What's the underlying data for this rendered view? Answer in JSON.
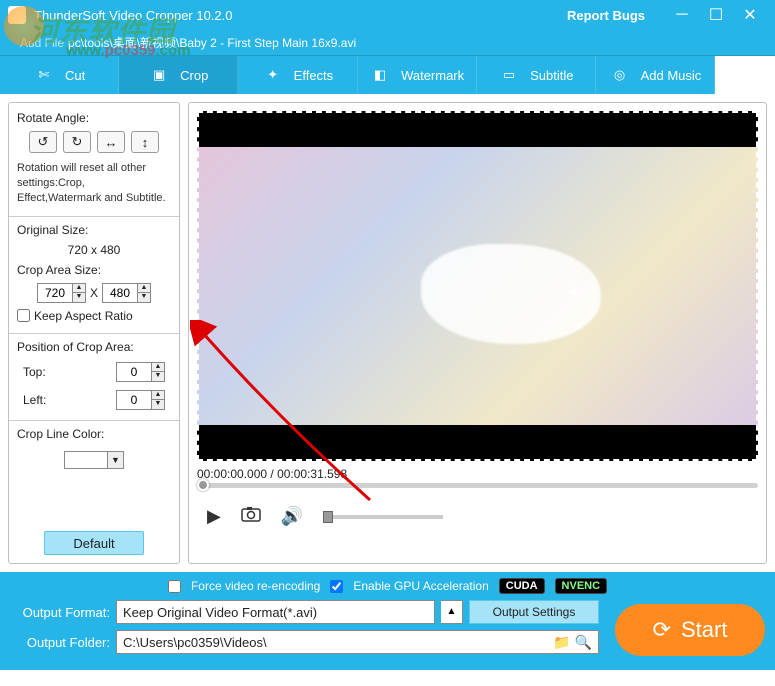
{
  "title": "ThunderSoft Video Cropper 10.2.0",
  "titlebar": {
    "report_bugs": "Report Bugs"
  },
  "subbar": {
    "added_file_path": "pc\\tools\\桌面\\新视频\\Baby 2 - First Step Main 16x9.avi"
  },
  "tabs": {
    "cut": "Cut",
    "crop": "Crop",
    "effects": "Effects",
    "watermark": "Watermark",
    "subtitle": "Subtitle",
    "add_music": "Add Music"
  },
  "left": {
    "rotate_angle": "Rotate Angle:",
    "note": "Rotation will reset all other settings:Crop, Effect,Watermark and Subtitle.",
    "original_size_label": "Original Size:",
    "original_size_value": "720 x 480",
    "crop_area_size_label": "Crop Area Size:",
    "crop_w": "720",
    "crop_h": "480",
    "keep_aspect": "Keep Aspect Ratio",
    "position_label": "Position of Crop Area:",
    "top_label": "Top:",
    "top_val": "0",
    "left_label": "Left:",
    "left_val": "0",
    "crop_line_color": "Crop Line Color:",
    "default_btn": "Default"
  },
  "preview": {
    "time": "00:00:00.000 / 00:00:31.598"
  },
  "bottom": {
    "force_reencode": "Force video re-encoding",
    "enable_gpu": "Enable GPU Acceleration",
    "cuda": "CUDA",
    "nvenc": "NVENC",
    "output_format_label": "Output Format:",
    "output_format_value": "Keep Original Video Format(*.avi)",
    "output_settings_btn": "Output Settings",
    "output_folder_label": "Output Folder:",
    "output_folder_value": "C:\\Users\\pc0359\\Videos\\",
    "start_btn": "Start"
  },
  "watermark_sitetext": "河东软件园",
  "watermark_url1": "www.",
  "watermark_url2": "pc0359"
}
